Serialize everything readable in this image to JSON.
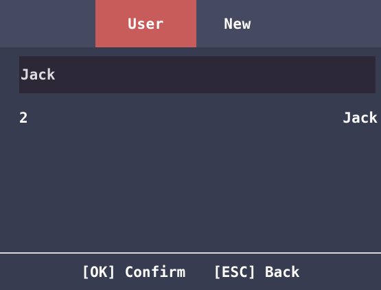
{
  "colors": {
    "background": "#383c51",
    "header_background": "#464a60",
    "active_tab": "#c75c5a",
    "search_background": "#2c2838",
    "text": "#ffffff",
    "divider": "#d8d8de"
  },
  "tabs": [
    {
      "label": "User",
      "active": true
    },
    {
      "label": "New",
      "active": false
    }
  ],
  "search": {
    "value": "Jack"
  },
  "results": [
    {
      "id": "2",
      "name": "Jack"
    }
  ],
  "footer": {
    "confirm_label": "[OK] Confirm",
    "back_label": "[ESC] Back"
  }
}
